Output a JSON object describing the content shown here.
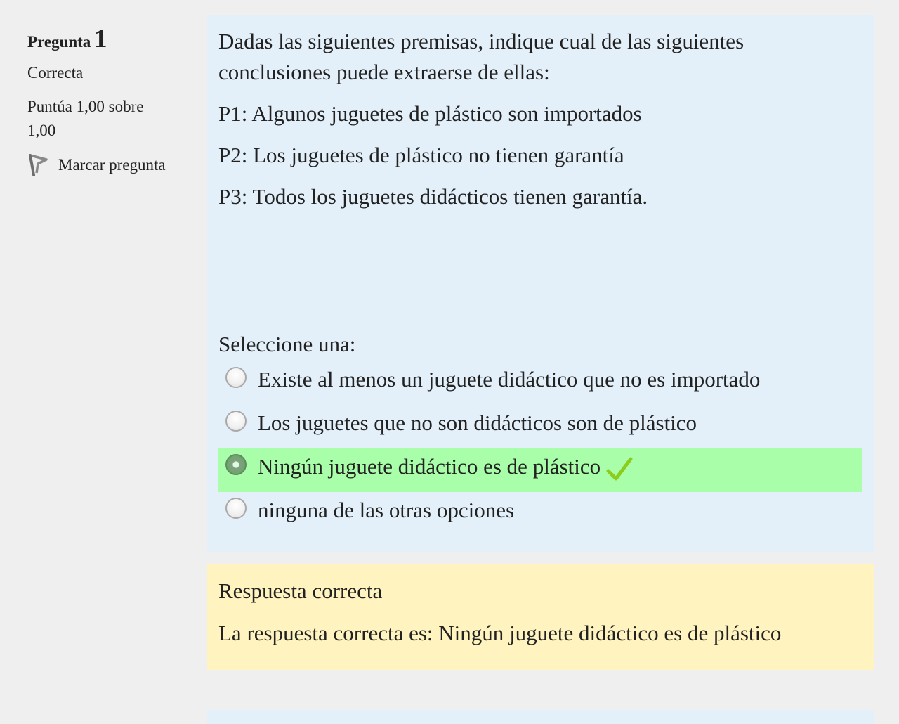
{
  "question": {
    "label": "Pregunta",
    "number": "1",
    "state": "Correcta",
    "grade": "Puntúa 1,00 sobre 1,00",
    "flag_label": "Marcar pregunta",
    "flag_icon": "flag-icon"
  },
  "formulation": {
    "text": "Dadas las siguientes premisas, indique cual de las siguientes conclusiones puede extraerse de ellas:",
    "premises": [
      "P1:  Algunos juguetes de plástico son importados",
      "P2: Los juguetes de plástico no tienen garantía",
      "P3: Todos los juguetes didácticos tienen garantía."
    ],
    "prompt": "Seleccione una:",
    "options": [
      {
        "label": "Existe al menos un juguete didáctico que no es importado",
        "selected": false,
        "correct": false
      },
      {
        "label": "Los juguetes que no son didácticos son de plástico",
        "selected": false,
        "correct": false
      },
      {
        "label": "Ningún juguete didáctico es de plástico",
        "selected": true,
        "correct": true
      },
      {
        "label": "ninguna de las otras opciones",
        "selected": false,
        "correct": false
      }
    ]
  },
  "feedback": {
    "result": "Respuesta correcta",
    "right_answer": "La respuesta correcta es: Ningún juguete didáctico es de plástico"
  },
  "colors": {
    "formulation_bg": "#e4f0f9",
    "correct_bg": "#a9ffa9",
    "feedback_bg": "#fff3bf",
    "check": "#8ccc1c"
  }
}
